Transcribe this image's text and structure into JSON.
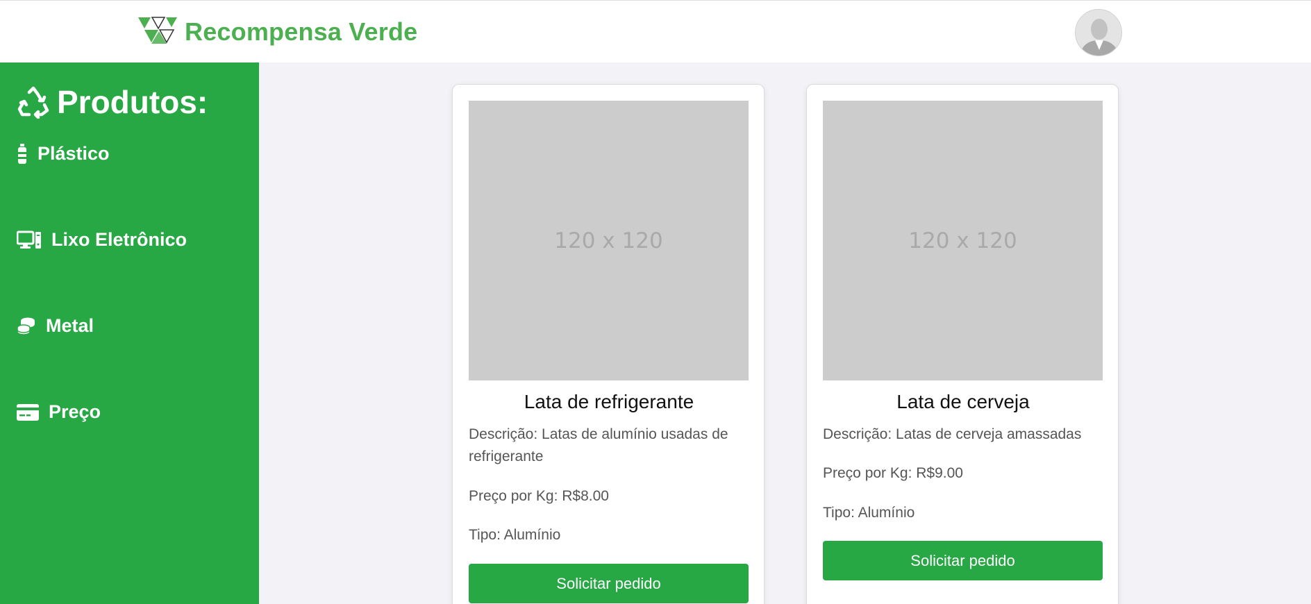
{
  "header": {
    "brand_name": "Recompensa Verde",
    "logo_icon": "recycle-triangles-logo",
    "avatar_icon": "user-avatar"
  },
  "sidebar": {
    "title": "Produtos:",
    "title_icon": "recycle-icon",
    "items": [
      {
        "label": "Plástico",
        "icon": "bottle-icon"
      },
      {
        "label": "Lixo Eletrônico",
        "icon": "computer-icon"
      },
      {
        "label": "Metal",
        "icon": "coins-icon"
      },
      {
        "label": "Preço",
        "icon": "credit-card-icon"
      }
    ]
  },
  "products": [
    {
      "image_placeholder": "120 x 120",
      "title": "Lata de refrigerante",
      "description": "Descrição: Latas de alumínio usadas de refrigerante",
      "price": "Preço por Kg: R$8.00",
      "type": "Tipo: Alumínio",
      "button": "Solicitar pedido"
    },
    {
      "image_placeholder": "120 x 120",
      "title": "Lata de cerveja",
      "description": "Descrição: Latas de cerveja amassadas",
      "price": "Preço por Kg: R$9.00",
      "type": "Tipo: Alumínio",
      "button": "Solicitar pedido"
    }
  ],
  "colors": {
    "brand_green": "#4caf50",
    "sidebar_green": "#28a745",
    "page_background": "#f2f2f7"
  }
}
